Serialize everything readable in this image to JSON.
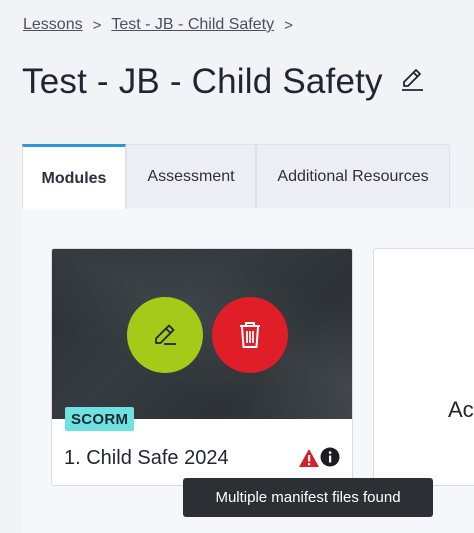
{
  "breadcrumb": {
    "items": [
      "Lessons",
      "Test - JB - Child Safety"
    ],
    "separator": ">"
  },
  "page": {
    "title": "Test - JB - Child Safety"
  },
  "tabs": [
    {
      "label": "Modules",
      "active": true
    },
    {
      "label": "Assessment",
      "active": false
    },
    {
      "label": "Additional Resources",
      "active": false
    }
  ],
  "modules": [
    {
      "badge": "SCORM",
      "title": "1. Child Safe 2024",
      "edit_icon": "pencil-icon",
      "delete_icon": "trash-icon",
      "status_icons": [
        "warning-icon",
        "info-icon"
      ]
    },
    {
      "label": "Ac"
    }
  ],
  "tooltip": {
    "text": "Multiple manifest files found"
  },
  "colors": {
    "active_tab_accent": "#2d97d7",
    "edit_button": "#a7ca19",
    "delete_button": "#e01e28",
    "badge": "#6fe1e0",
    "warning": "#d62028",
    "tooltip_bg": "#2c2f33"
  }
}
